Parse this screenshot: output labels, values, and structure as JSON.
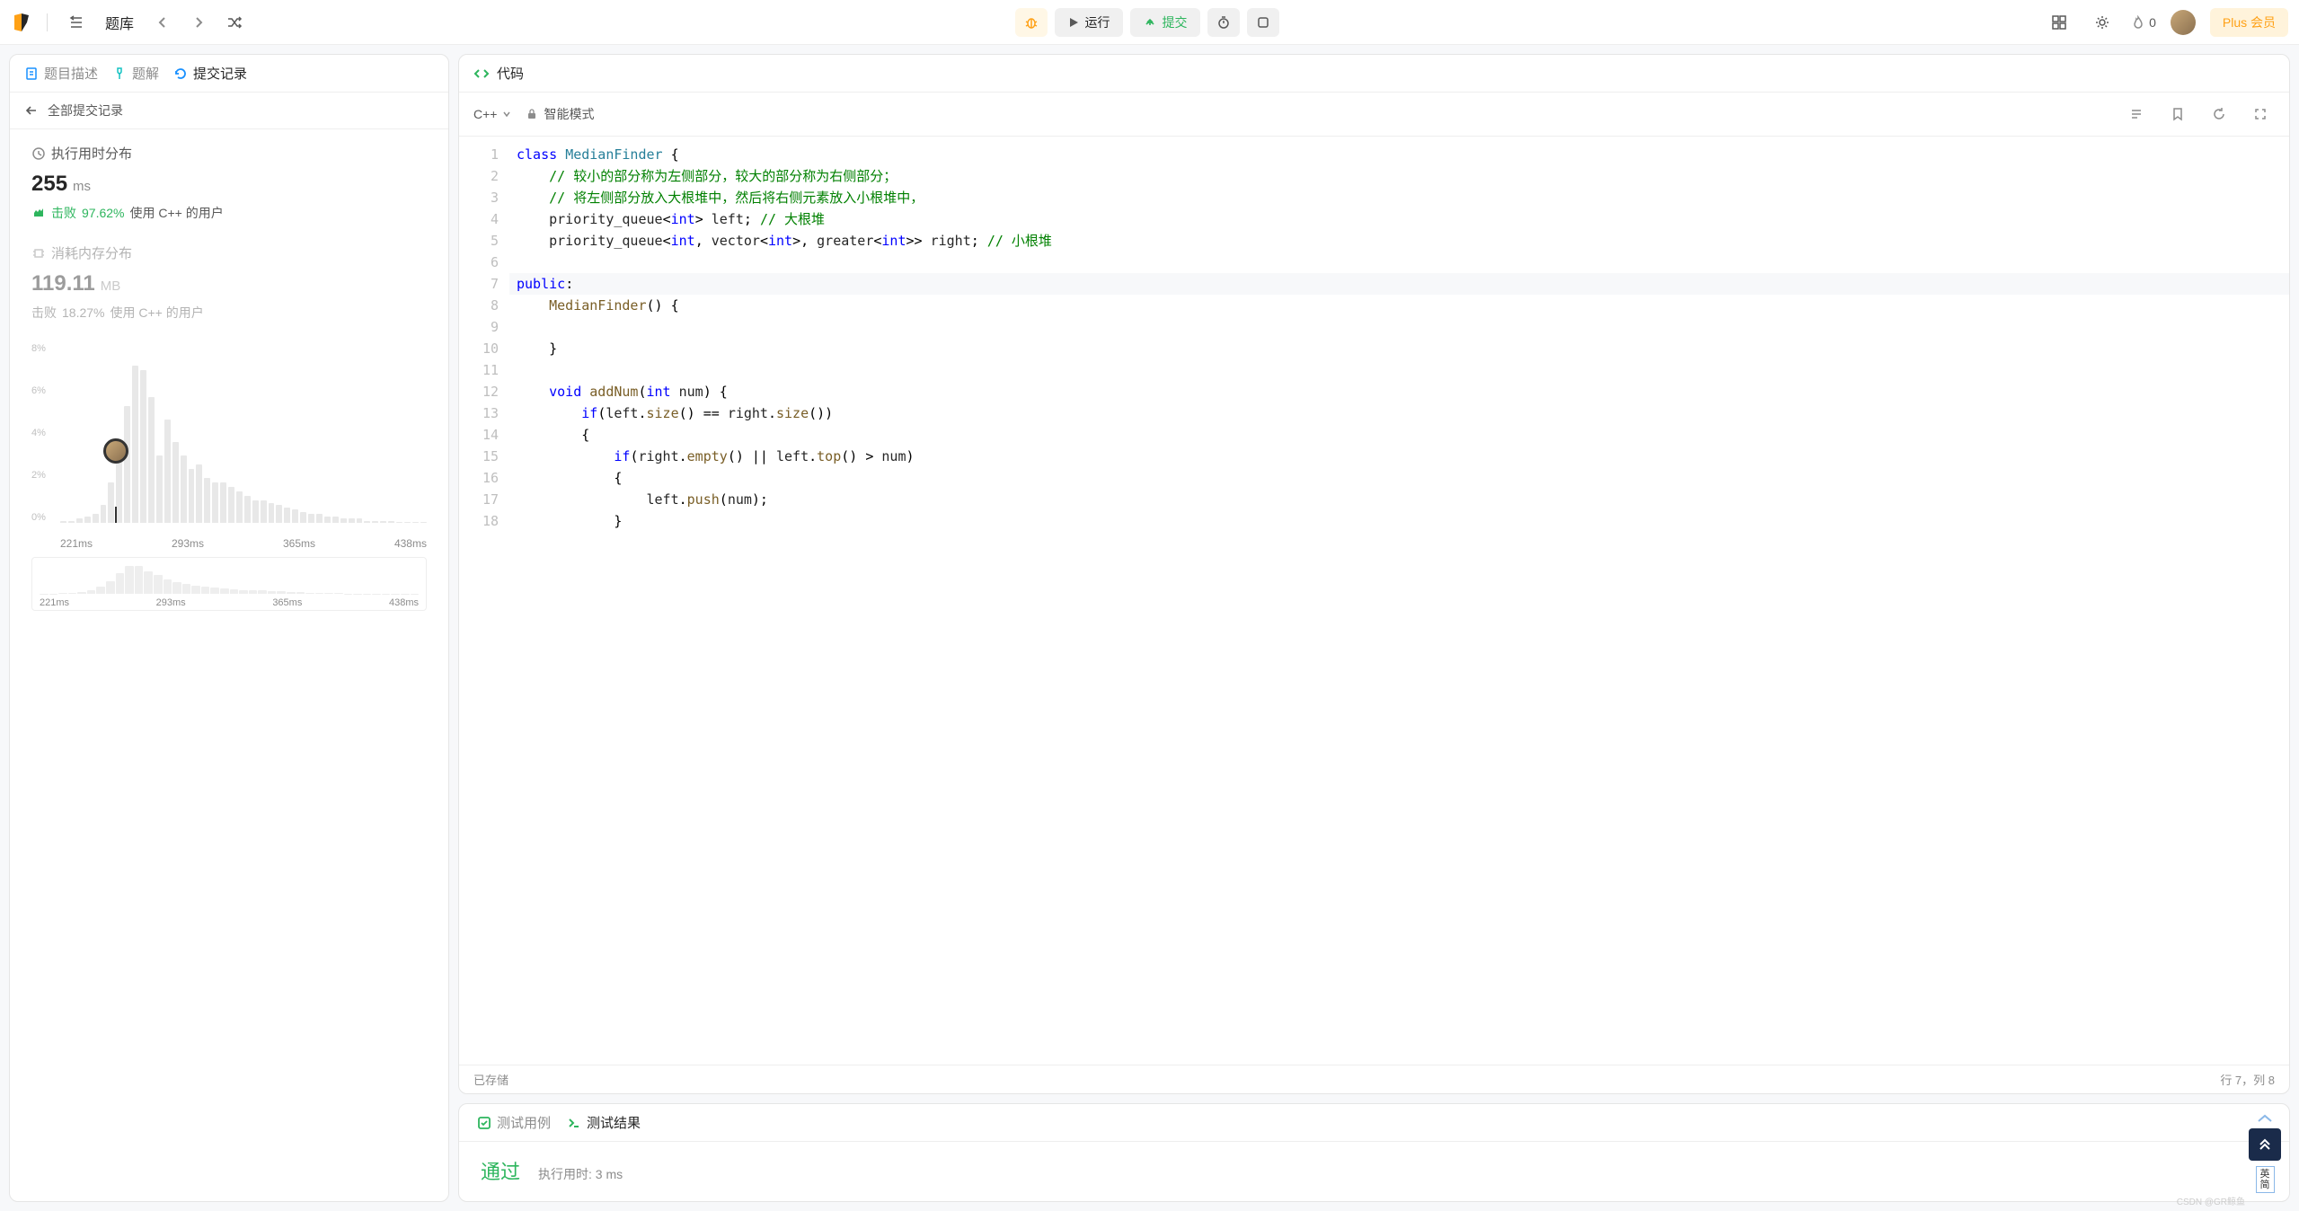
{
  "topbar": {
    "problem_list": "题库",
    "run": "运行",
    "submit": "提交",
    "streak_count": "0",
    "plus": "Plus 会员"
  },
  "left": {
    "tabs": {
      "description": "题目描述",
      "solution": "题解",
      "submissions": "提交记录"
    },
    "back": "全部提交记录",
    "runtime_title": "执行用时分布",
    "runtime_value": "255",
    "runtime_unit": "ms",
    "runtime_beat_label": "击败",
    "runtime_beat_pct": "97.62%",
    "runtime_beat_suffix": "使用 C++ 的用户",
    "memory_title": "消耗内存分布",
    "memory_value": "119.11",
    "memory_unit": "MB",
    "memory_beat_label": "击败",
    "memory_beat_pct": "18.27%",
    "memory_beat_suffix": "使用 C++ 的用户"
  },
  "chart_data": {
    "type": "bar",
    "title": "执行用时分布",
    "xlabel": "ms",
    "ylabel": "%",
    "ylim": [
      0,
      8
    ],
    "y_ticks": [
      "8%",
      "6%",
      "4%",
      "2%",
      "0%"
    ],
    "x_ticks": [
      "221ms",
      "293ms",
      "365ms",
      "438ms"
    ],
    "values": [
      0.1,
      0.1,
      0.2,
      0.3,
      0.4,
      0.8,
      1.8,
      3.2,
      5.2,
      7.0,
      6.8,
      5.6,
      3.0,
      4.6,
      3.6,
      3.0,
      2.4,
      2.6,
      2.0,
      1.8,
      1.8,
      1.6,
      1.4,
      1.2,
      1.0,
      1.0,
      0.9,
      0.8,
      0.7,
      0.6,
      0.5,
      0.4,
      0.4,
      0.3,
      0.3,
      0.2,
      0.2,
      0.2,
      0.1,
      0.1,
      0.1,
      0.1,
      0.05,
      0.05,
      0.05,
      0.05
    ],
    "marker_index": 7,
    "mini_values": [
      0.1,
      0.1,
      0.2,
      0.3,
      0.4,
      0.8,
      1.8,
      3.2,
      5.2,
      7.0,
      6.8,
      5.6,
      4.6,
      3.6,
      3.0,
      2.4,
      2.0,
      1.8,
      1.6,
      1.4,
      1.2,
      1.0,
      0.9,
      0.8,
      0.7,
      0.6,
      0.5,
      0.4,
      0.3,
      0.3,
      0.2,
      0.2,
      0.1,
      0.1,
      0.1,
      0.05,
      0.05,
      0.05,
      0.05,
      0.05
    ]
  },
  "code": {
    "title": "代码",
    "lang": "C++",
    "mode_label": "智能模式",
    "saved": "已存储",
    "cursor": "行 7，列 8",
    "lines": [
      {
        "n": 1,
        "t": [
          [
            "kw",
            "class"
          ],
          [
            "sp",
            " "
          ],
          [
            "cls",
            "MedianFinder"
          ],
          [
            "sp",
            " "
          ],
          [
            "op",
            "{"
          ]
        ]
      },
      {
        "n": 2,
        "t": [
          [
            "sp",
            "    "
          ],
          [
            "cm",
            "// 较小的部分称为左侧部分，较大的部分称为右侧部分；"
          ]
        ]
      },
      {
        "n": 3,
        "t": [
          [
            "sp",
            "    "
          ],
          [
            "cm",
            "// 将左侧部分放入大根堆中，然后将右侧元素放入小根堆中，"
          ]
        ]
      },
      {
        "n": 4,
        "t": [
          [
            "sp",
            "    "
          ],
          [
            "pl",
            "priority_queue"
          ],
          [
            "op",
            "<"
          ],
          [
            "ty",
            "int"
          ],
          [
            "op",
            "> "
          ],
          [
            "pl",
            "left"
          ],
          [
            "op",
            "; "
          ],
          [
            "cm",
            "// 大根堆"
          ]
        ]
      },
      {
        "n": 5,
        "t": [
          [
            "sp",
            "    "
          ],
          [
            "pl",
            "priority_queue"
          ],
          [
            "op",
            "<"
          ],
          [
            "ty",
            "int"
          ],
          [
            "op",
            ", "
          ],
          [
            "pl",
            "vector"
          ],
          [
            "op",
            "<"
          ],
          [
            "ty",
            "int"
          ],
          [
            "op",
            ">, "
          ],
          [
            "pl",
            "greater"
          ],
          [
            "op",
            "<"
          ],
          [
            "ty",
            "int"
          ],
          [
            "op",
            ">> "
          ],
          [
            "pl",
            "right"
          ],
          [
            "op",
            "; "
          ],
          [
            "cm",
            "// 小根堆"
          ]
        ]
      },
      {
        "n": 6,
        "t": []
      },
      {
        "n": 7,
        "hl": true,
        "t": [
          [
            "kw",
            "public"
          ],
          [
            "op",
            ":"
          ]
        ]
      },
      {
        "n": 8,
        "t": [
          [
            "sp",
            "    "
          ],
          [
            "fn",
            "MedianFinder"
          ],
          [
            "op",
            "() {"
          ]
        ]
      },
      {
        "n": 9,
        "t": []
      },
      {
        "n": 10,
        "t": [
          [
            "sp",
            "    "
          ],
          [
            "op",
            "}"
          ]
        ]
      },
      {
        "n": 11,
        "t": []
      },
      {
        "n": 12,
        "t": [
          [
            "sp",
            "    "
          ],
          [
            "ty",
            "void"
          ],
          [
            "sp",
            " "
          ],
          [
            "fn",
            "addNum"
          ],
          [
            "op",
            "("
          ],
          [
            "ty",
            "int"
          ],
          [
            "sp",
            " "
          ],
          [
            "pl",
            "num"
          ],
          [
            "op",
            ") {"
          ]
        ]
      },
      {
        "n": 13,
        "t": [
          [
            "sp",
            "        "
          ],
          [
            "kw",
            "if"
          ],
          [
            "op",
            "("
          ],
          [
            "pl",
            "left"
          ],
          [
            "op",
            "."
          ],
          [
            "fn",
            "size"
          ],
          [
            "op",
            "() == "
          ],
          [
            "pl",
            "right"
          ],
          [
            "op",
            "."
          ],
          [
            "fn",
            "size"
          ],
          [
            "op",
            "())"
          ]
        ]
      },
      {
        "n": 14,
        "t": [
          [
            "sp",
            "        "
          ],
          [
            "op",
            "{"
          ]
        ]
      },
      {
        "n": 15,
        "t": [
          [
            "sp",
            "            "
          ],
          [
            "kw",
            "if"
          ],
          [
            "op",
            "("
          ],
          [
            "pl",
            "right"
          ],
          [
            "op",
            "."
          ],
          [
            "fn",
            "empty"
          ],
          [
            "op",
            "() || "
          ],
          [
            "pl",
            "left"
          ],
          [
            "op",
            "."
          ],
          [
            "fn",
            "top"
          ],
          [
            "op",
            "() > "
          ],
          [
            "pl",
            "num"
          ],
          [
            "op",
            ")"
          ]
        ]
      },
      {
        "n": 16,
        "t": [
          [
            "sp",
            "            "
          ],
          [
            "op",
            "{"
          ]
        ]
      },
      {
        "n": 17,
        "t": [
          [
            "sp",
            "                "
          ],
          [
            "pl",
            "left"
          ],
          [
            "op",
            "."
          ],
          [
            "fn",
            "push"
          ],
          [
            "op",
            "("
          ],
          [
            "pl",
            "num"
          ],
          [
            "op",
            ");"
          ]
        ]
      },
      {
        "n": 18,
        "t": [
          [
            "sp",
            "            "
          ],
          [
            "op",
            "}"
          ]
        ]
      }
    ]
  },
  "result": {
    "testcase_tab": "测试用例",
    "result_tab": "测试结果",
    "pass": "通过",
    "runtime_label": "执行用时: 3 ms"
  },
  "ime": {
    "l1": "英",
    "l2": "简"
  },
  "watermark": "CSDN @GR鲸鱼"
}
